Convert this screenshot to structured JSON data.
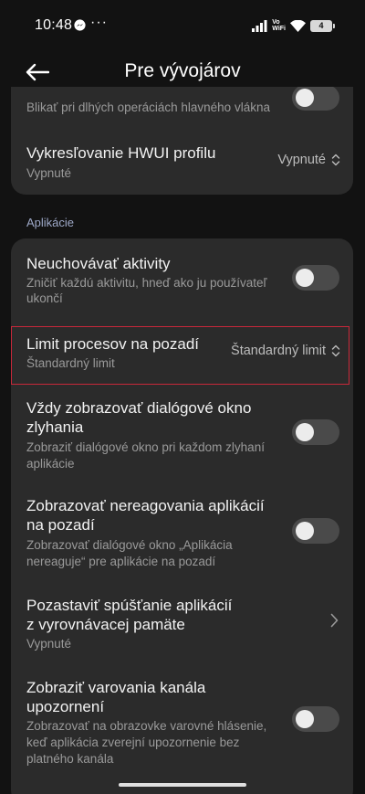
{
  "status_bar": {
    "time": "10:48",
    "dots": "···",
    "network_top": "Vo",
    "network_bottom": "WiFi",
    "battery": "4"
  },
  "header": {
    "title": "Pre vývojárov"
  },
  "top_card": {
    "partial_subtitle": "Blikať pri dlhých operáciách hlavného vlákna",
    "hwui_title": "Vykresľovanie HWUI profilu",
    "hwui_sub": "Vypnuté",
    "hwui_value": "Vypnuté"
  },
  "section": {
    "label": "Aplikácie"
  },
  "items": [
    {
      "title": "Neuchovávať aktivity",
      "subtitle_l1": "Zničiť každú aktivitu, hneď ako ju používateľ",
      "subtitle_l2": "ukončí",
      "control": "toggle",
      "on": false
    },
    {
      "title": "Limit procesov na pozadí",
      "subtitle": "Štandardný limit",
      "value": "Štandardný limit",
      "control": "select"
    },
    {
      "title_l1": "Vždy zobrazovať dialógové okno",
      "title_l2": "zlyhania",
      "subtitle_l1": "Zobraziť dialógové okno pri každom zlyhaní",
      "subtitle_l2": "aplikácie",
      "control": "toggle",
      "on": false
    },
    {
      "title_l1": "Zobrazovať nereagovania aplikácií",
      "title_l2": "na pozadí",
      "subtitle_l1": "Zobrazovať dialógové okno „Aplikácia",
      "subtitle_l2": "nereaguje“ pre aplikácie na pozadí",
      "control": "toggle",
      "on": false
    },
    {
      "title_l1": "Pozastaviť spúšťanie aplikácií",
      "title_l2": "z vyrovnávacej pamäte",
      "subtitle": "Vypnuté",
      "control": "chevron"
    },
    {
      "title_l1": "Zobraziť varovania kanála",
      "title_l2": "upozornení",
      "subtitle_l1": "Zobrazovať na obrazovke varovné hlásenie,",
      "subtitle_l2": "keď aplikácia zverejní upozornenie bez",
      "subtitle_l3": "platného kanála",
      "control": "toggle",
      "on": false
    }
  ]
}
